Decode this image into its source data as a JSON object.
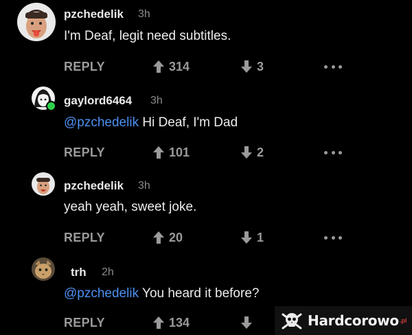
{
  "comments": [
    {
      "username": "pzchedelik",
      "time": "3h",
      "mention": "",
      "text": "I'm Deaf, legit need subtitles.",
      "reply_label": "REPLY",
      "upvotes": "314",
      "downvotes": "3"
    },
    {
      "username": "gaylord6464",
      "time": "3h",
      "mention": "@pzchedelik",
      "text": " Hi Deaf, I'm Dad",
      "reply_label": "REPLY",
      "upvotes": "101",
      "downvotes": "2"
    },
    {
      "username": "pzchedelik",
      "time": "3h",
      "mention": "",
      "text": "yeah yeah, sweet joke.",
      "reply_label": "REPLY",
      "upvotes": "20",
      "downvotes": "1"
    },
    {
      "username": "trh",
      "time": "2h",
      "mention": "@pzchedelik",
      "text": " You heard it before?",
      "reply_label": "REPLY",
      "upvotes": "134",
      "downvotes": ""
    }
  ],
  "watermark": {
    "brand": "Hardcorowo",
    "tld": ".pl"
  },
  "colors": {
    "background": "#000000",
    "mention": "#4d8ff0",
    "online": "#2bd14a",
    "muted": "#9a9a9a"
  },
  "icons": {
    "upvote": "arrow-up-icon",
    "downvote": "arrow-down-icon",
    "more": "more-dots-icon",
    "watermark": "skull-logo-icon"
  }
}
